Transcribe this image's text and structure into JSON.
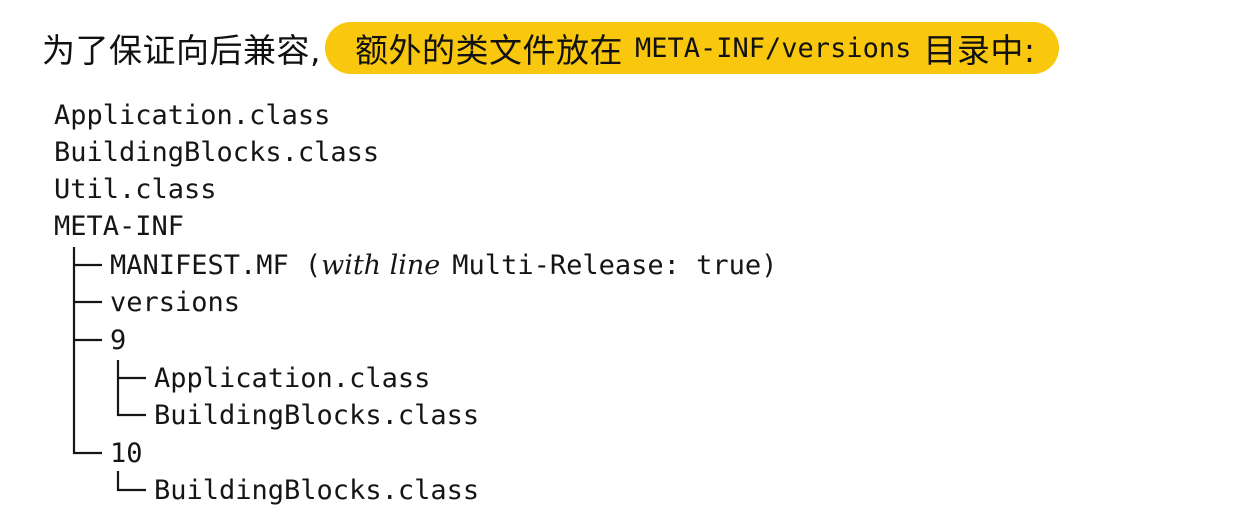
{
  "heading": {
    "lead_text": "为了保证向后兼容,",
    "highlight": {
      "before": "额外的类文件放在",
      "code": "META-INF/versions",
      "after": "目录中:"
    },
    "highlight_color": "#f9c80e"
  },
  "tree": {
    "root_items": [
      "Application.class",
      "BuildingBlocks.class",
      "Util.class",
      "META-INF"
    ],
    "manifest": {
      "name": "MANIFEST.MF",
      "open_paren": "(",
      "note_italic": "with line",
      "note_value": "Multi-Release: true",
      "close_paren": ")"
    },
    "versions_dir": "versions",
    "v9": {
      "name": "9",
      "files": [
        "Application.class",
        "BuildingBlocks.class"
      ]
    },
    "v10": {
      "name": "10",
      "files": [
        "BuildingBlocks.class"
      ]
    }
  }
}
